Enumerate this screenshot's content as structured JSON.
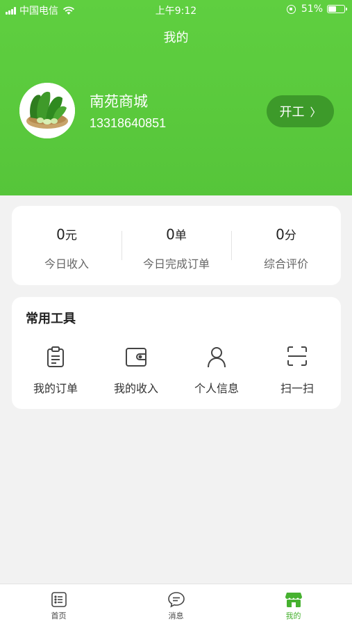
{
  "status_bar": {
    "carrier": "中国电信",
    "time": "上午9:12",
    "battery": "51%",
    "battery_level": 0.51
  },
  "header": {
    "title": "我的",
    "shop_name": "南苑商城",
    "phone": "13318640851",
    "start_button": "开工",
    "start_button_arrow": "〉"
  },
  "stats": [
    {
      "value": "0",
      "unit": "元",
      "label": "今日收入"
    },
    {
      "value": "0",
      "unit": "单",
      "label": "今日完成订单"
    },
    {
      "value": "0",
      "unit": "分",
      "label": "综合评价"
    }
  ],
  "tools": {
    "title": "常用工具",
    "items": [
      {
        "label": "我的订单",
        "icon": "clipboard-icon"
      },
      {
        "label": "我的收入",
        "icon": "wallet-icon"
      },
      {
        "label": "个人信息",
        "icon": "person-icon"
      },
      {
        "label": "扫一扫",
        "icon": "scan-icon"
      }
    ]
  },
  "tabbar": {
    "items": [
      {
        "label": "首页",
        "icon": "list-icon",
        "active": false
      },
      {
        "label": "消息",
        "icon": "chat-icon",
        "active": false
      },
      {
        "label": "我的",
        "icon": "store-icon",
        "active": true
      }
    ]
  },
  "colors": {
    "brand_green": "#56c53a",
    "button_dark_green": "#3d9a2a",
    "active_tab": "#46b12f",
    "background": "#f2f2f2"
  }
}
